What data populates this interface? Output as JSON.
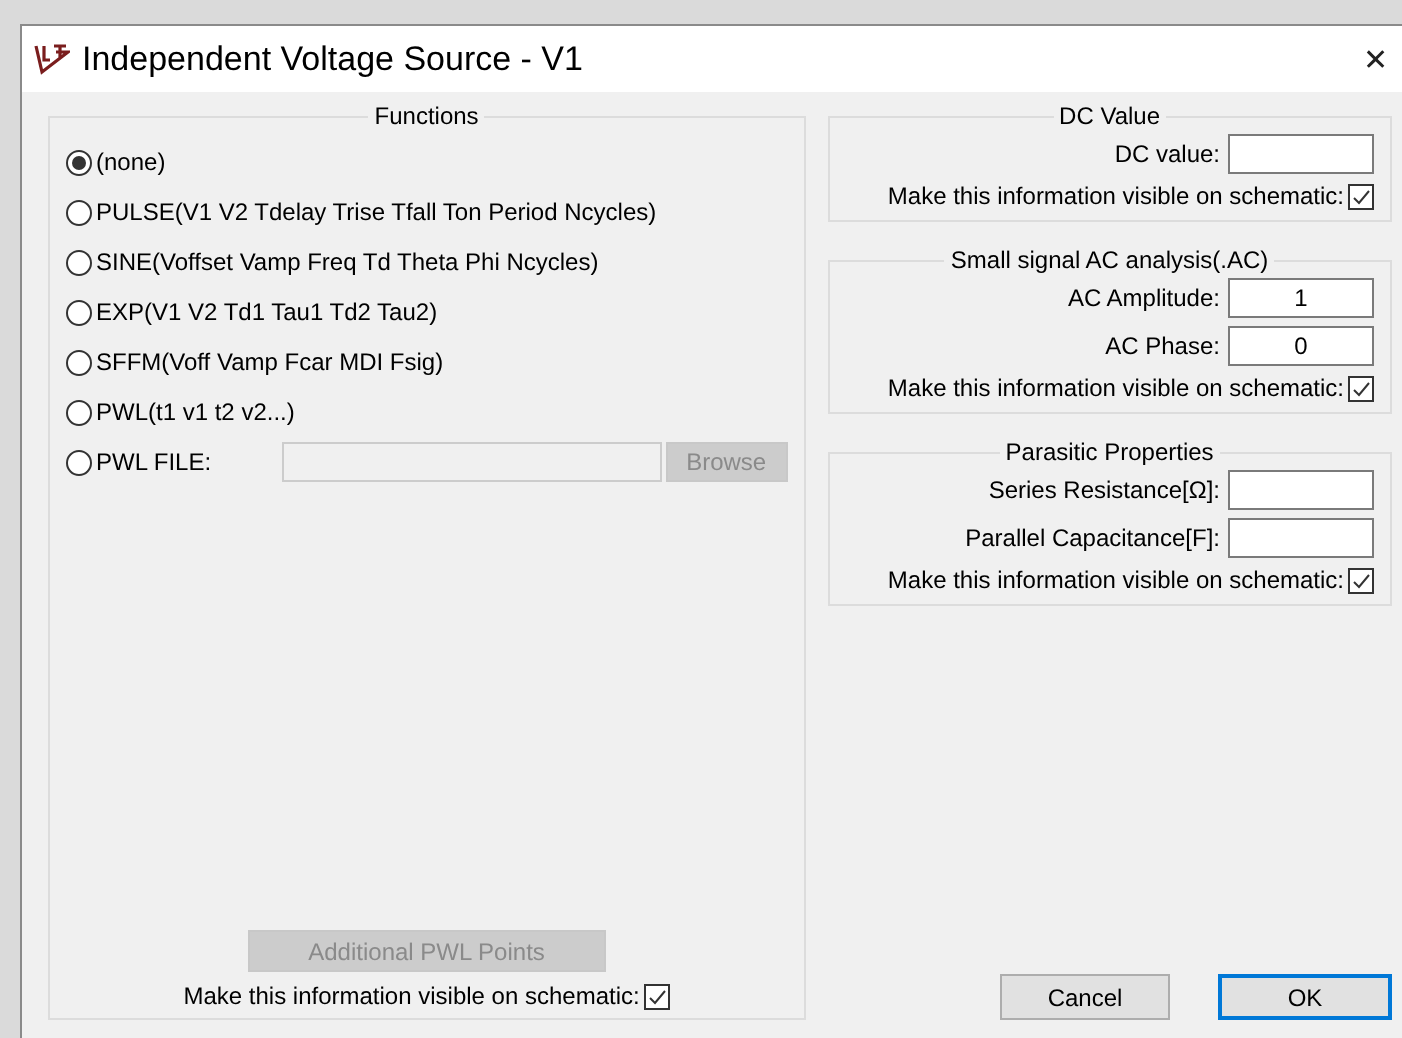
{
  "window": {
    "title": "Independent Voltage Source - V1",
    "close": "✕"
  },
  "functions": {
    "title": "Functions",
    "options": [
      {
        "label": "(none)",
        "selected": true
      },
      {
        "label": "PULSE(V1 V2 Tdelay Trise Tfall Ton Period Ncycles)",
        "selected": false
      },
      {
        "label": "SINE(Voffset Vamp Freq Td Theta Phi Ncycles)",
        "selected": false
      },
      {
        "label": "EXP(V1 V2 Td1 Tau1 Td2 Tau2)",
        "selected": false
      },
      {
        "label": "SFFM(Voff Vamp Fcar MDI Fsig)",
        "selected": false
      },
      {
        "label": "PWL(t1 v1 t2 v2...)",
        "selected": false
      },
      {
        "label": "PWL FILE:",
        "selected": false,
        "kind": "file"
      }
    ],
    "file_field": {
      "disabled": true
    },
    "browse_button": {
      "label": "Browse",
      "disabled": true
    },
    "pwl_points_button": {
      "label": "Additional PWL Points",
      "disabled": true
    },
    "visible": {
      "label": "Make this information visible on schematic:",
      "checked": true
    }
  },
  "groups": [
    {
      "title": "DC Value",
      "fields": [
        {
          "label": "DC value:"
        }
      ],
      "visible": {
        "label": "Make this information visible on schematic:",
        "checked": true
      }
    },
    {
      "title": "Small signal AC analysis(.AC)",
      "fields": [
        {
          "label": "AC Amplitude:",
          "value": "1"
        },
        {
          "label": "AC Phase:",
          "value": "0"
        }
      ],
      "visible": {
        "label": "Make this information visible on schematic:",
        "checked": true
      }
    },
    {
      "title": "Parasitic Properties",
      "fields": [
        {
          "label": "Series Resistance[Ω]:"
        },
        {
          "label": "Parallel Capacitance[F]:"
        }
      ],
      "visible": {
        "label": "Make this information visible on schematic:",
        "checked": true
      }
    }
  ],
  "buttons": [
    {
      "label": "Cancel",
      "default": false
    },
    {
      "label": "OK",
      "default": true
    }
  ]
}
